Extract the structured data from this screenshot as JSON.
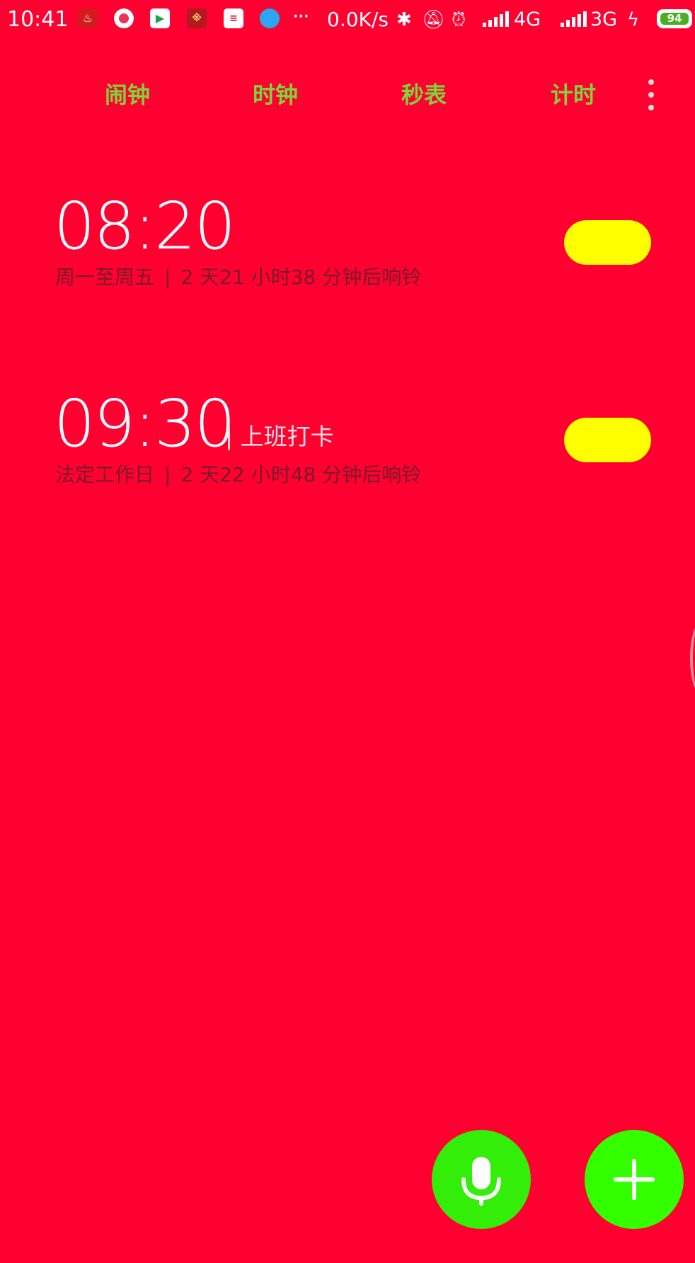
{
  "status_bar": {
    "time": "10:41",
    "more": "···",
    "net_speed": "0.0K/s",
    "network_1": "4G",
    "network_2": "3G",
    "battery_level": "94",
    "icons": [
      "fire-app-icon",
      "circle-app-icon",
      "video-app-icon",
      "news-app-icon",
      "calendar-app-icon",
      "browser-app-icon",
      "bluetooth-icon",
      "muted-bell-icon",
      "alarm-clock-icon",
      "signal-icon",
      "signal-icon",
      "charging-icon",
      "battery-icon"
    ]
  },
  "tabs": [
    {
      "label": "闹钟"
    },
    {
      "label": "时钟"
    },
    {
      "label": "秒表"
    },
    {
      "label": "计时"
    }
  ],
  "alarms": [
    {
      "time": "08:20",
      "label": "",
      "repeat": "周一至周五",
      "separator": "|",
      "countdown": "2 天21 小时38 分钟后响铃",
      "enabled": true
    },
    {
      "time": "09:30",
      "label": "| 上班打卡",
      "repeat": "法定工作日",
      "separator": "|",
      "countdown": "2 天22 小时48 分钟后响铃",
      "enabled": true
    }
  ],
  "colors": {
    "background": "#FF0030",
    "tab_text": "#7CD63A",
    "toggle": "#FFFF00",
    "fab": "#33FF00"
  }
}
